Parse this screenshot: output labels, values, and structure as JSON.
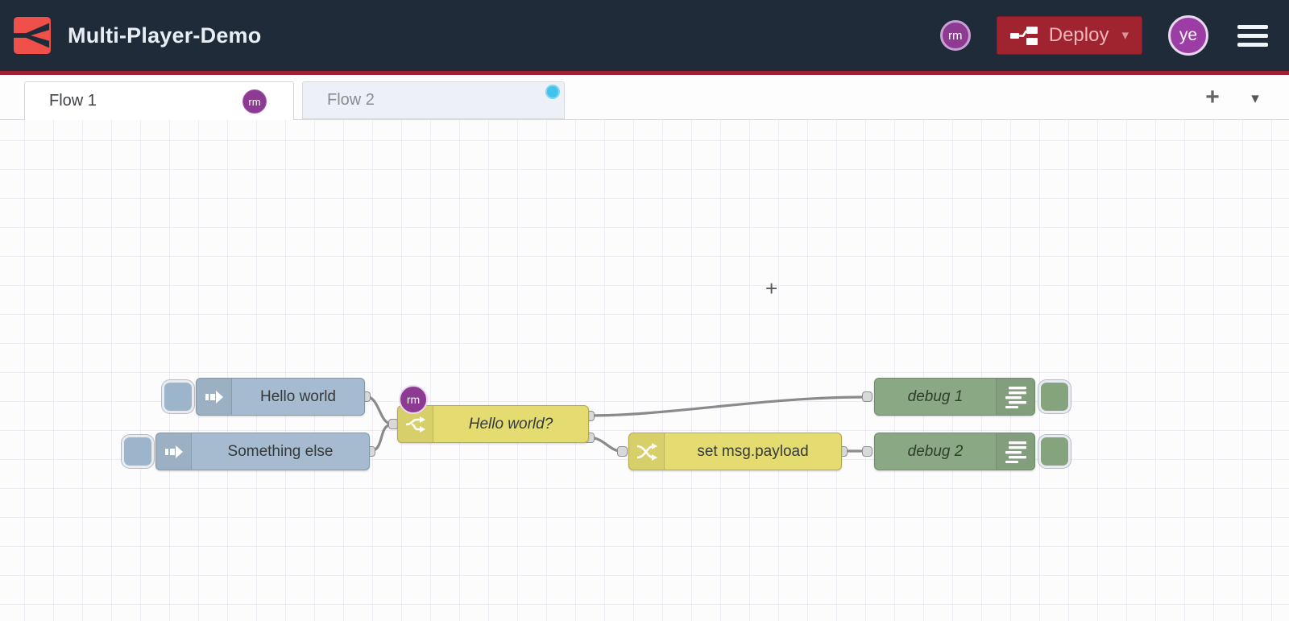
{
  "header": {
    "title": "Multi-Player-Demo",
    "logo_icon": "flowfuse-logo",
    "collaborator_badge": "rm",
    "deploy": {
      "label": "Deploy",
      "caret_icon": "▾"
    },
    "user_badge": "ye",
    "menu_icon": "hamburger-icon"
  },
  "tab_bar": {
    "tabs": [
      {
        "label": "Flow 1",
        "active": true,
        "badge": "rm"
      },
      {
        "label": "Flow 2",
        "active": false,
        "activity_dot": true
      }
    ],
    "add_flow_icon": "+",
    "flow_list_icon": "▾"
  },
  "canvas": {
    "cursor_glyph": "+",
    "nodes": [
      {
        "id": "inject-hello-world",
        "type": "inject",
        "label": "Hello world"
      },
      {
        "id": "inject-something-else",
        "type": "inject",
        "label": "Something else"
      },
      {
        "id": "switch-hello-world",
        "type": "switch",
        "label": "Hello world?",
        "badge": "rm",
        "outputs": 2
      },
      {
        "id": "change-set-payload",
        "type": "change",
        "label": "set msg.payload"
      },
      {
        "id": "debug-1",
        "type": "debug",
        "label": "debug 1"
      },
      {
        "id": "debug-2",
        "type": "debug",
        "label": "debug 2"
      }
    ],
    "wires": [
      {
        "from": "inject-hello-world",
        "to": "switch-hello-world"
      },
      {
        "from": "inject-something-else",
        "to": "switch-hello-world"
      },
      {
        "from": "switch-hello-world:1",
        "to": "debug-1"
      },
      {
        "from": "switch-hello-world:2",
        "to": "change-set-payload"
      },
      {
        "from": "change-set-payload",
        "to": "debug-2"
      }
    ]
  },
  "colors": {
    "header_bg": "#1f2b39",
    "accent_red": "#9e2133",
    "logo_red": "#f0504a",
    "deploy_red": "#a02330",
    "avatar_purple": "#8d3a92",
    "inject_node": "#a6bbcf",
    "function_node": "#e4db71",
    "debug_node": "#8ba884",
    "activity_dot": "#45c2ec",
    "wire_gray": "#8a8a8a"
  }
}
